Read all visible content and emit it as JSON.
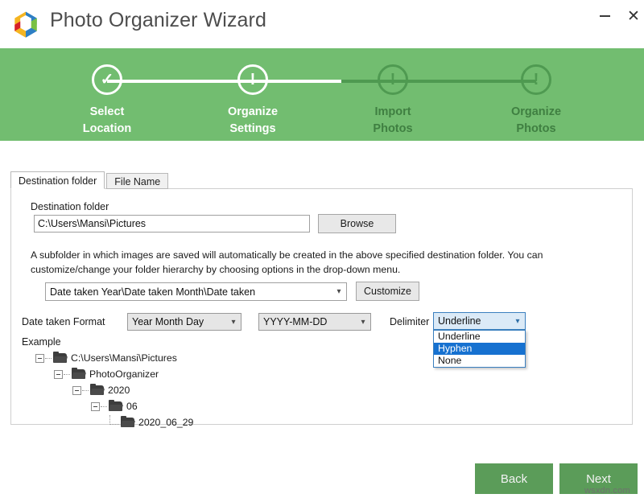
{
  "window": {
    "title": "Photo Organizer Wizard",
    "logo_icon": "hexagon-colorful-logo",
    "minimize_label": "−",
    "minimize_icon": "minimize-icon",
    "close_label": "✕",
    "close_icon": "close-icon"
  },
  "stepper": {
    "accent_active": "#72bd70",
    "accent_inactive": "#4f9a51",
    "steps": [
      {
        "line1": "Select",
        "line2": "Location",
        "glyph": "✓",
        "icon": "check-icon",
        "state": "done"
      },
      {
        "line1": "Organize",
        "line2": "Settings",
        "glyph": "!",
        "icon": "exclamation-icon",
        "state": "active"
      },
      {
        "line1": "Import",
        "line2": "Photos",
        "glyph": "!",
        "icon": "exclamation-icon",
        "state": "inactive"
      },
      {
        "line1": "Organize",
        "line2": "Photos",
        "glyph": "!",
        "icon": "exclamation-icon",
        "state": "inactive"
      }
    ]
  },
  "tabs": [
    {
      "label": "Destination folder",
      "active": true
    },
    {
      "label": "File Name",
      "active": false
    }
  ],
  "panel": {
    "destination_label": "Destination folder",
    "destination_value": "C:\\Users\\Mansi\\Pictures",
    "destination_placeholder": "",
    "browse_label": "Browse",
    "description": "A subfolder in which images are saved will automatically be created in the above specified destination folder. You can customize/change your folder hierarchy by choosing options in the drop-down menu.",
    "hierarchy_value": "Date taken Year\\Date taken Month\\Date taken",
    "customize_label": "Customize",
    "format_label": "Date taken Format",
    "format_value": "Year Month Day",
    "pattern_value": "YYYY-MM-DD",
    "delimiter_label": "Delimiter",
    "delimiter_value": "Underline",
    "delimiter_options": [
      "Underline",
      "Hyphen",
      "None"
    ],
    "delimiter_highlighted": "Hyphen",
    "dropdown_arrow": "⌄",
    "example_label": "Example",
    "tree": [
      {
        "label": "C:\\Users\\Mansi\\Pictures",
        "depth": 0,
        "expandable": true,
        "last": false
      },
      {
        "label": "PhotoOrganizer",
        "depth": 1,
        "expandable": true,
        "last": false
      },
      {
        "label": "2020",
        "depth": 2,
        "expandable": true,
        "last": false
      },
      {
        "label": "06",
        "depth": 3,
        "expandable": true,
        "last": false
      },
      {
        "label": "2020_06_29",
        "depth": 4,
        "expandable": false,
        "last": true
      }
    ]
  },
  "footer": {
    "back_label": "Back",
    "next_label": "Next",
    "button_color": "#5b9c59",
    "watermark": "wsxdn.com"
  }
}
